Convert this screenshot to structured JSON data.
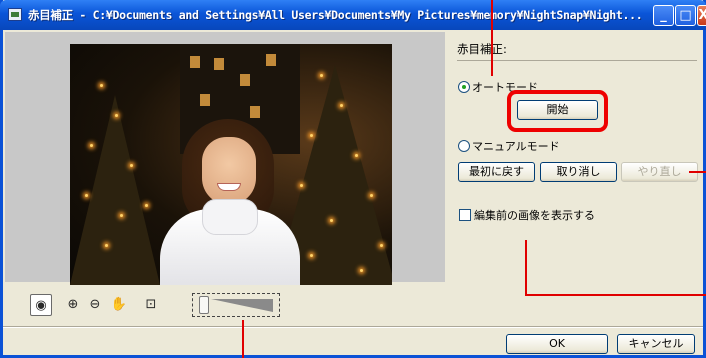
{
  "window": {
    "title": "赤目補正 - C:¥Documents and Settings¥All Users¥Documents¥My Pictures¥memory¥NightSnap¥Night...",
    "min_glyph": "_",
    "max_glyph": "□",
    "close_glyph": "X"
  },
  "panel": {
    "group_title": "赤目補正:",
    "auto_mode_label": "オートモード",
    "start_button": "開始",
    "manual_mode_label": "マニュアルモード",
    "reset_button": "最初に戻す",
    "undo_button": "取り消し",
    "redo_button": "やり直し",
    "show_original_label": "編集前の画像を表示する",
    "selected_mode": "auto"
  },
  "toolbar": {
    "tools": [
      {
        "name": "red-eye-tool-icon",
        "glyph": "◉",
        "pressed": true
      },
      {
        "name": "zoom-in-icon",
        "glyph": "⊕"
      },
      {
        "name": "zoom-out-icon",
        "glyph": "⊖"
      },
      {
        "name": "hand-pan-icon",
        "glyph": "✋"
      },
      {
        "name": "fit-to-window-icon",
        "glyph": "⊡"
      }
    ]
  },
  "footer": {
    "ok_button": "OK",
    "cancel_button": "キャンセル"
  },
  "colors": {
    "title_bar": "#0a55d8",
    "dialog_bg": "#ece9d8",
    "callout": "#e00000"
  }
}
